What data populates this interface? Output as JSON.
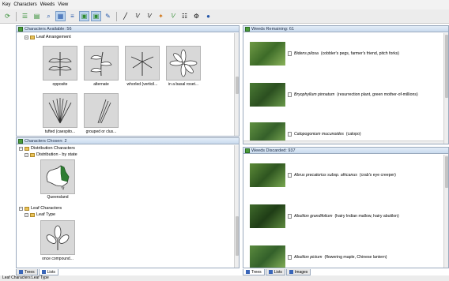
{
  "menu": [
    "Key",
    "Characters",
    "Weeds",
    "View"
  ],
  "toolbar": {
    "icons": [
      "refresh-icon",
      "tree-view-icon",
      "list-view-icon",
      "search-icon",
      "grid-icon",
      "filter-icon",
      "match-icon",
      "unmatch-icon",
      "tag-icon",
      "pen-icon",
      "fraction-icon",
      "fraction-alt-icon",
      "pin-icon",
      "fraction-green-icon",
      "sort-icon",
      "settings-icon",
      "help-icon"
    ]
  },
  "characters_available": {
    "title": "Characters Available: 56",
    "tree_label": "Leaf Arrangement",
    "thumbs": [
      {
        "label": "opposite"
      },
      {
        "label": "alternate"
      },
      {
        "label": "whorled (verticil..."
      },
      {
        "label": "in a basal roset..."
      },
      {
        "label": "tufted (caespito..."
      },
      {
        "label": "grouped or clus..."
      }
    ]
  },
  "characters_chosen": {
    "title": "Characters Chosen: 2",
    "tree": [
      {
        "label": "Distribution Characters"
      },
      {
        "label": "Distribution - by state"
      },
      {
        "label": "Leaf Characters"
      },
      {
        "label": "Leaf Type"
      }
    ],
    "thumbs": [
      {
        "label": "Queensland"
      },
      {
        "label": "once compound..."
      }
    ]
  },
  "left_tabs": [
    {
      "label": "Trees",
      "selected": false
    },
    {
      "label": "Lists",
      "selected": true
    }
  ],
  "weeds_remaining": {
    "title": "Weeds Remaining: 61",
    "items": [
      {
        "name": "Bidens pilosa",
        "common": "(cobbler's pegs, farmer's friend, pitch forks)",
        "color": "#5a8a3a"
      },
      {
        "name": "Bryophyllum pinnatum",
        "common": "(resurrection plant, green mother-of-millions)",
        "color": "#3f6e2c"
      },
      {
        "name": "Calopogonium mucunoides",
        "common": "(calopo)",
        "color": "#4d7f33"
      }
    ]
  },
  "weeds_discarded": {
    "title": "Weeds Discarded: 937",
    "items": [
      {
        "name": "Abrus precatorius subsp. africanus",
        "common": "(crab's eye creeper)",
        "color": "#4c7a2f"
      },
      {
        "name": "Abutilon grandifolium",
        "common": "(hairy Indian mallow, hairy abutilon)",
        "color": "#2f5a22"
      },
      {
        "name": "Abutilon pictum",
        "common": "(flowering maple, Chinese lantern)",
        "color": "#4b7533"
      }
    ]
  },
  "right_tabs": [
    {
      "label": "Trees",
      "selected": true
    },
    {
      "label": "Lists",
      "selected": false
    },
    {
      "label": "Images",
      "selected": false
    }
  ],
  "status_text": "Leaf Characters:Leaf Type"
}
